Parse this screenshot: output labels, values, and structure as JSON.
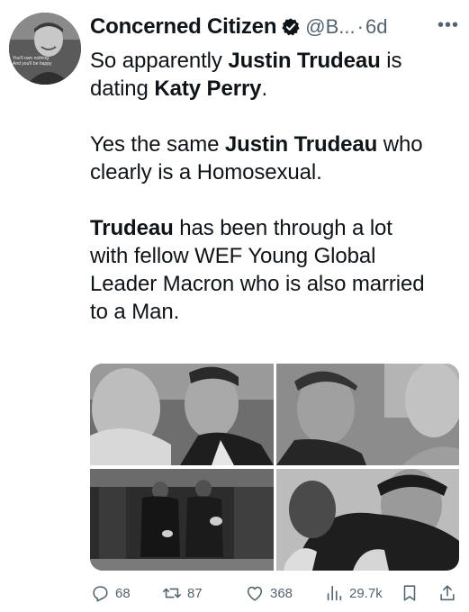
{
  "author": {
    "display_name": "Concerned Citizen",
    "handle": "@B...",
    "separator": "·",
    "time": "6d",
    "avatar_text_line1": "You'll own nothing",
    "avatar_text_line2": "And you'll be happy"
  },
  "tweet": {
    "line1_pre": "So apparently ",
    "line1_bold": "Justin Trudeau",
    "line1_post": " is",
    "line2_bold": "Katy Perry",
    "line2_pre": "dating ",
    "line2_post": ".",
    "line3_pre": "Yes the same ",
    "line3_bold": "Justin Trudeau",
    "line3_post": " who",
    "line4": "clearly is a Homosexual.",
    "line5_bold": "Trudeau",
    "line5_post": " has been through a lot",
    "line6": "with fellow WEF Young Global",
    "line7": "Leader Macron who is also married",
    "line8": "to a Man."
  },
  "actions": {
    "replies": "68",
    "retweets": "87",
    "likes": "368",
    "views": "29.7k"
  },
  "icons": {
    "verified": "verified-badge-icon",
    "more": "more-icon",
    "reply": "reply-icon",
    "retweet": "retweet-icon",
    "like": "heart-icon",
    "views": "views-icon",
    "bookmark": "bookmark-icon",
    "share": "share-icon"
  },
  "colors": {
    "text": "#0f1419",
    "secondary": "#536471"
  }
}
